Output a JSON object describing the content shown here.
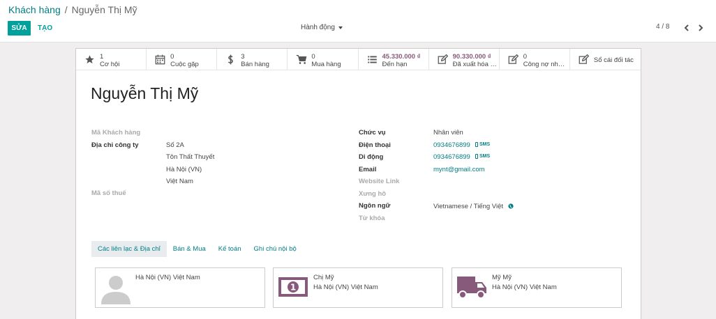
{
  "breadcrumb": {
    "parent": "Khách hàng",
    "separator": "/",
    "current": "Nguyễn Thị Mỹ"
  },
  "toolbar": {
    "edit_label": "SỬA",
    "create_label": "TẠO",
    "action_label": "Hành động"
  },
  "pager": {
    "value": "4 / 8"
  },
  "smart_buttons": [
    {
      "value": "1",
      "label": "Cơ hội",
      "icon": "star-icon"
    },
    {
      "value": "0",
      "label": "Cuộc gặp",
      "icon": "calendar-icon"
    },
    {
      "value": "3",
      "label": "Bán hàng",
      "icon": "dollar-icon"
    },
    {
      "value": "0",
      "label": "Mua hàng",
      "icon": "cart-icon"
    },
    {
      "value": "45.330.000 ₫",
      "label": "Đến hạn",
      "icon": "list-icon"
    },
    {
      "value": "90.330.000 ₫",
      "label": "Đã xuất hóa đơn",
      "icon": "edit-icon"
    },
    {
      "value": "0",
      "label": "Công nợ nhà cung cấp",
      "icon": "edit-icon"
    },
    {
      "label": "Sổ cái đối tác",
      "icon": "edit-icon"
    }
  ],
  "partner": {
    "name": "Nguyễn Thị Mỹ",
    "left_fields": {
      "ref_label": "Mã Khách hàng",
      "address_label": "Địa chỉ công ty",
      "address_lines": [
        "Số 2A",
        "Tôn Thất Thuyết",
        "Hà Nội (VN)",
        "Việt Nam"
      ],
      "vat_label": "Mã số thuế"
    },
    "right_fields": {
      "function_label": "Chức vụ",
      "function_value": "Nhân viên",
      "phone_label": "Điện thoại",
      "phone_value": "0934676899",
      "mobile_label": "Di động",
      "mobile_value": "0934676899",
      "sms_label": "SMS",
      "email_label": "Email",
      "email_value": "mynt@gmail.com",
      "website_label": "Website Link",
      "title_label": "Xưng hô",
      "lang_label": "Ngôn ngữ",
      "lang_value": "Vietnamese / Tiếng Việt",
      "tags_label": "Từ khóa"
    }
  },
  "tabs": [
    {
      "label": "Các liên lạc & Địa chỉ",
      "active": true
    },
    {
      "label": "Bán & Mua"
    },
    {
      "label": "Kế toán"
    },
    {
      "label": "Ghi chú nội bộ"
    }
  ],
  "contacts": [
    {
      "name": "",
      "address": "Hà Nội (VN) Việt Nam",
      "icon": "avatar-placeholder-icon"
    },
    {
      "name": "Chị Mỹ",
      "address": "Hà Nội (VN) Việt Nam",
      "icon": "invoice-money-icon"
    },
    {
      "name": "Mỹ Mỹ",
      "address": "Hà Nội (VN) Việt Nam",
      "icon": "delivery-truck-icon"
    }
  ],
  "colors": {
    "primary": "#00a09d",
    "link": "#017e84",
    "accent": "#875a7b"
  }
}
